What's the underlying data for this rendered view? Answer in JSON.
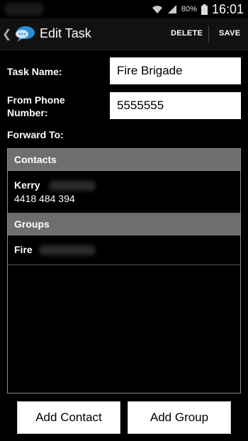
{
  "status_bar": {
    "battery_percent": "80%",
    "time": "16:01",
    "icons": [
      "wifi-icon",
      "signal-icon",
      "battery-icon"
    ]
  },
  "action_bar": {
    "title": "Edit Task",
    "delete_label": "DELETE",
    "save_label": "SAVE",
    "logo": "chat-bubble-logo"
  },
  "form": {
    "task_name_label": "Task Name:",
    "task_name_value": "Fire Brigade",
    "from_phone_label_1": "From Phone",
    "from_phone_label_2": "Number:",
    "from_phone_value": "5555555",
    "forward_to_label": "Forward To:"
  },
  "forward_list": {
    "contacts_header": "Contacts",
    "contacts": [
      {
        "name": "Kerry",
        "phone": "4418 484 394"
      }
    ],
    "groups_header": "Groups",
    "groups": [
      {
        "name": "Fire"
      }
    ]
  },
  "buttons": {
    "add_contact": "Add Contact",
    "add_group": "Add Group"
  },
  "colors": {
    "background": "#000000",
    "section_header": "#6e6e6e",
    "logo_blue": "#2a8fd6"
  }
}
